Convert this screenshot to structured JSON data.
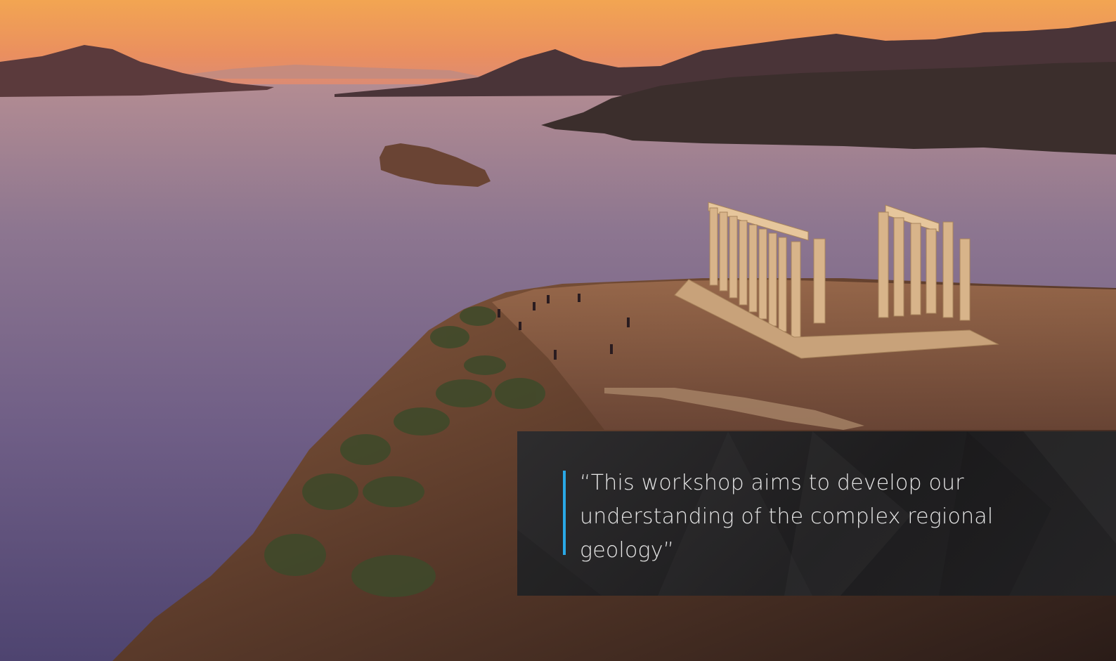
{
  "scene": {
    "description_icon": "temple-of-poseidon-sunset-photo",
    "colors": {
      "sky_top": "#f0a458",
      "sky_horizon": "#e98f63",
      "sea": "#7d6a8e",
      "panel": "#2a2a2c",
      "accent": "#2aa8e6"
    }
  },
  "quote": {
    "text": "“This workshop aims to develop our understanding of the complex regional geology”"
  }
}
